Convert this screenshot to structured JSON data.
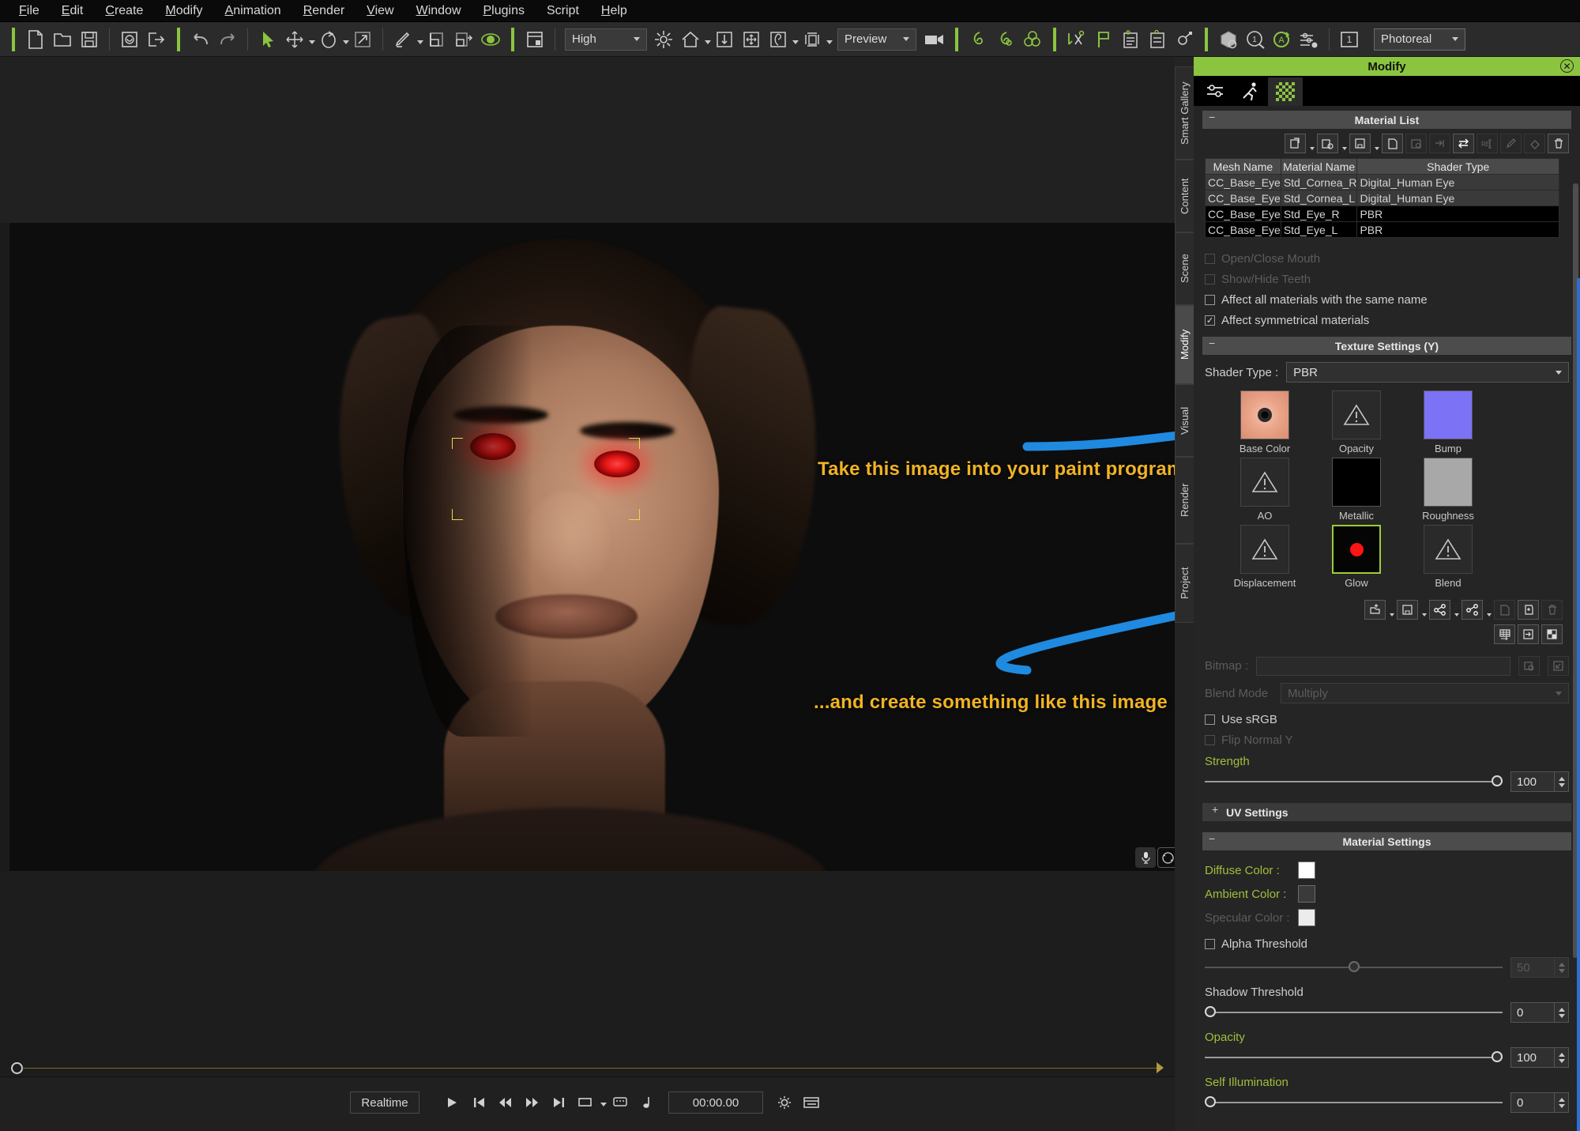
{
  "app": {
    "menu": [
      "File",
      "Edit",
      "Create",
      "Modify",
      "Animation",
      "Render",
      "View",
      "Window",
      "Plugins",
      "Script",
      "Help"
    ]
  },
  "toolbar": {
    "quality_value": "High",
    "preview_value": "Preview",
    "render_mode_value": "Photoreal",
    "frame_value": "1",
    "icons": [
      "new-document-icon",
      "open-folder-icon",
      "save-icon",
      "import-icon",
      "export-icon",
      "undo-icon",
      "redo-icon",
      "select-arrow-icon",
      "move-icon",
      "rotate-icon",
      "scale-icon",
      "edit-mesh-icon",
      "align-left-icon",
      "align-right-icon",
      "eye-visibility-icon",
      "layer-panel-icon",
      "light-icon",
      "home-icon",
      "ground-icon",
      "move-all-icon",
      "physics-icon",
      "box-icon",
      "camera-icon",
      "spring-icon",
      "softcloth-icon",
      "collision-icon",
      "motion-icon",
      "flag-icon",
      "list-icon",
      "settings-list-icon",
      "pivot-icon",
      "render-object-icon",
      "preview-render-icon",
      "auto-icon",
      "render-settings-icon"
    ]
  },
  "viewport": {
    "annotation_top": "Take this image into your paint program...",
    "annotation_bottom": "...and create something like this image",
    "overlay_icons": [
      "microphone-icon",
      "orbit-icon"
    ]
  },
  "timeline": {
    "mode": "Realtime",
    "timecode": "00:00.00",
    "buttons": [
      "play-icon",
      "jump-start-icon",
      "rewind-icon",
      "fast-forward-icon",
      "jump-end-icon",
      "range-icon",
      "comment-icon",
      "audio-note-icon",
      "settings-gear-icon",
      "timeline-panel-icon"
    ]
  },
  "sidetabs": {
    "items": [
      {
        "label": "Smart Gallery",
        "active": false
      },
      {
        "label": "Content",
        "active": false
      },
      {
        "label": "Scene",
        "active": false
      },
      {
        "label": "Modify",
        "active": true
      },
      {
        "label": "Visual",
        "active": false
      },
      {
        "label": "Render",
        "active": false
      },
      {
        "label": "Project",
        "active": false
      }
    ]
  },
  "panel": {
    "title": "Modify",
    "close_icon": "close-icon",
    "tabs": [
      {
        "name": "attribute-tab",
        "icon": "sliders-icon",
        "active": false
      },
      {
        "name": "motion-tab",
        "icon": "running-man-icon",
        "active": false
      },
      {
        "name": "material-tab",
        "icon": "checker-swatch-icon",
        "active": true
      }
    ],
    "material_list": {
      "heading": "Material List",
      "toolbar_icons": [
        "load-material-icon",
        "load-preset-icon",
        "save-material-icon",
        "copy-icon",
        "paste-icon",
        "apply-icon",
        "swap-icon",
        "rename-icon",
        "eyedropper-icon",
        "fill-icon",
        "delete-icon"
      ],
      "columns": [
        "Mesh Name",
        "Material Name",
        "Shader Type"
      ],
      "rows": [
        {
          "mesh": "CC_Base_Eye",
          "material": "Std_Cornea_R",
          "shader": "Digital_Human Eye",
          "selected": true
        },
        {
          "mesh": "CC_Base_Eye",
          "material": "Std_Cornea_L",
          "shader": "Digital_Human Eye",
          "selected": true
        },
        {
          "mesh": "CC_Base_Eye",
          "material": "Std_Eye_R",
          "shader": "PBR",
          "selected": false
        },
        {
          "mesh": "CC_Base_Eye",
          "material": "Std_Eye_L",
          "shader": "PBR",
          "selected": false
        }
      ]
    },
    "checkboxes": [
      {
        "label": "Open/Close Mouth",
        "checked": false,
        "disabled": true
      },
      {
        "label": "Show/Hide Teeth",
        "checked": false,
        "disabled": true
      },
      {
        "label": "Affect all materials with the same name",
        "checked": false,
        "disabled": false
      },
      {
        "label": "Affect symmetrical materials",
        "checked": true,
        "disabled": false
      }
    ],
    "texture_settings": {
      "heading": "Texture Settings  (Y)",
      "shader_type_label": "Shader Type :",
      "shader_type_value": "PBR",
      "channels": [
        {
          "label": "Base Color",
          "state": "image",
          "color": "#e5a089",
          "selected": false
        },
        {
          "label": "Opacity",
          "state": "empty",
          "selected": false
        },
        {
          "label": "Bump",
          "state": "color",
          "color": "#7b72f6",
          "selected": false
        },
        {
          "label": "AO",
          "state": "empty",
          "selected": false
        },
        {
          "label": "Metallic",
          "state": "color",
          "color": "#000000",
          "selected": false
        },
        {
          "label": "Roughness",
          "state": "color",
          "color": "#a8a8a8",
          "selected": false
        },
        {
          "label": "Displacement",
          "state": "empty",
          "selected": false
        },
        {
          "label": "Glow",
          "state": "glow",
          "color": "#ff1414",
          "selected": true
        },
        {
          "label": "Blend",
          "state": "empty",
          "selected": false
        }
      ],
      "channel_toolbar_icons": [
        "load-texture-icon",
        "save-texture-icon",
        "link-icon",
        "unlink-icon",
        "copy-texture-icon",
        "paste-texture-icon",
        "delete-texture-icon",
        "uv-grid-icon",
        "send-to-icon",
        "split-icon"
      ],
      "bitmap_label": "Bitmap :",
      "bitmap_value": "",
      "bitmap_icons": [
        "browse-icon",
        "open-external-icon"
      ],
      "blend_mode_label": "Blend Mode",
      "blend_mode_value": "Multiply",
      "use_srgb": {
        "label": "Use sRGB",
        "checked": false,
        "disabled": false
      },
      "flip_normal_y": {
        "label": "Flip Normal Y",
        "checked": false,
        "disabled": true
      },
      "strength": {
        "label": "Strength",
        "value": "100",
        "percent": 100
      },
      "uv_settings": {
        "label": "UV Settings",
        "expanded": false
      }
    },
    "material_settings": {
      "heading": "Material Settings",
      "diffuse": {
        "label": "Diffuse Color :",
        "color": "#ffffff",
        "disabled": false
      },
      "ambient": {
        "label": "Ambient Color :",
        "color": "#3a3a3a",
        "disabled": false
      },
      "specular": {
        "label": "Specular Color :",
        "color": "#ececec",
        "disabled": true
      },
      "alpha_threshold": {
        "label": "Alpha Threshold",
        "checked": false,
        "value": "50",
        "percent": 50,
        "disabled": true
      },
      "shadow_threshold": {
        "label": "Shadow Threshold",
        "value": "0",
        "percent": 0
      },
      "opacity": {
        "label": "Opacity",
        "value": "100",
        "percent": 100
      },
      "self_illumination": {
        "label": "Self Illumination",
        "value": "0",
        "percent": 0
      }
    }
  },
  "colors": {
    "accent_green": "#8bc53f",
    "annotation_yellow": "#f0b323",
    "arrow_blue": "#1f8ae0",
    "panel_bg": "#252525"
  }
}
